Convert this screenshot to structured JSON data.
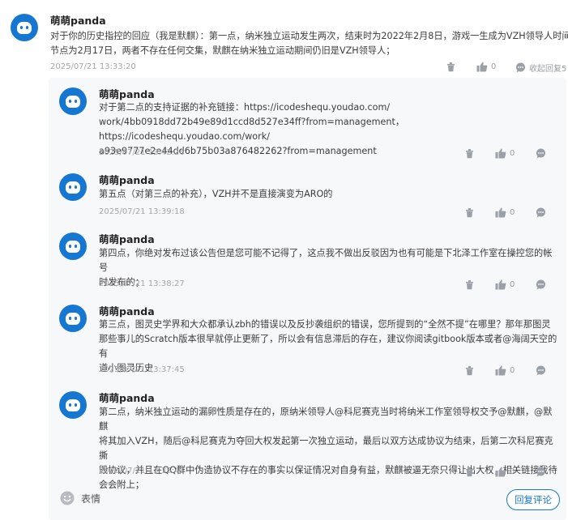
{
  "main_comment": {
    "author": "萌萌panda",
    "text_line1": "对于你的历史指控的回应（我是默麒）：第一点，纳米独立运动发生两次，结束时为2022年2月8日，游戏一生成为VZH领导人时间",
    "text_line2": "节点为2月17日，两者不存在任何交集，默麒在纳米独立运动期间仍旧是VZH领导人；",
    "time": "2025/07/21 13:33:20",
    "likes": "0",
    "collapse_label": "收起回复5"
  },
  "replies": [
    {
      "author": "萌萌panda",
      "lines": [
        "对于第二点的支持证据的补充链接：https://icodeshequ.youdao.com/",
        "work/4bb0918dd72b49e89d1ccd8d527e34ff?from=management，https://icodeshequ.youdao.com/work/",
        "a93e9777e2e44dd6b75b03a876482262?from=management"
      ],
      "time": "2025/07/21 13:42:26",
      "likes": "0"
    },
    {
      "author": "萌萌panda",
      "lines": [
        "第五点（对第三点的补充），VZH并不是直接演变为ARO的"
      ],
      "time": "2025/07/21 13:39:18",
      "likes": "0"
    },
    {
      "author": "萌萌panda",
      "lines": [
        "第四点，你绝对发布过该公告但是您可能不记得了，这点我不做出反驳因为也有可能是下北泽工作室在操控您的帐号",
        "时发布的；"
      ],
      "time": "2025/07/21 13:38:27",
      "likes": "0"
    },
    {
      "author": "萌萌panda",
      "lines": [
        "第三点，图灵史学界和大众都承认zbh的错误以及反抄袭组织的错误，您所提到的“全然不提”在哪里？那年那图灵",
        "那些事儿的Scratch版本很早就停止更新了，所以会有信息滞后的存在，建议你阅读gitbook版本或者@海阔天空的有",
        "道小图灵历史"
      ],
      "time": "2025/07/21 13:37:45",
      "likes": "0"
    },
    {
      "author": "萌萌panda",
      "lines": [
        "第二点，纳米独立运动的漏卵性质是存在的，原纳米领导人@科尼赛克当时将纳米工作室领导权交予@默麒，@默麒",
        "将其加入VZH，随后@科尼赛克为夺回大权发起第一次独立运动，最后以双方达成协议为结束，后第二次科尼赛克撕",
        "毁协议，并且在QQ群中伪造协议不存在的事实以保证情况对自身有益，默麒被逼无奈只得让出大权，相关链接我待",
        "会会附上；"
      ],
      "time": "2025/07/21 13:35:41",
      "likes": "0"
    }
  ],
  "footer": {
    "emoji_label": "表情",
    "reply_button": "回复评论"
  },
  "icons": [
    "avatar-icon",
    "trash-icon",
    "thumbs-up-icon",
    "comment-icon",
    "smile-icon"
  ]
}
